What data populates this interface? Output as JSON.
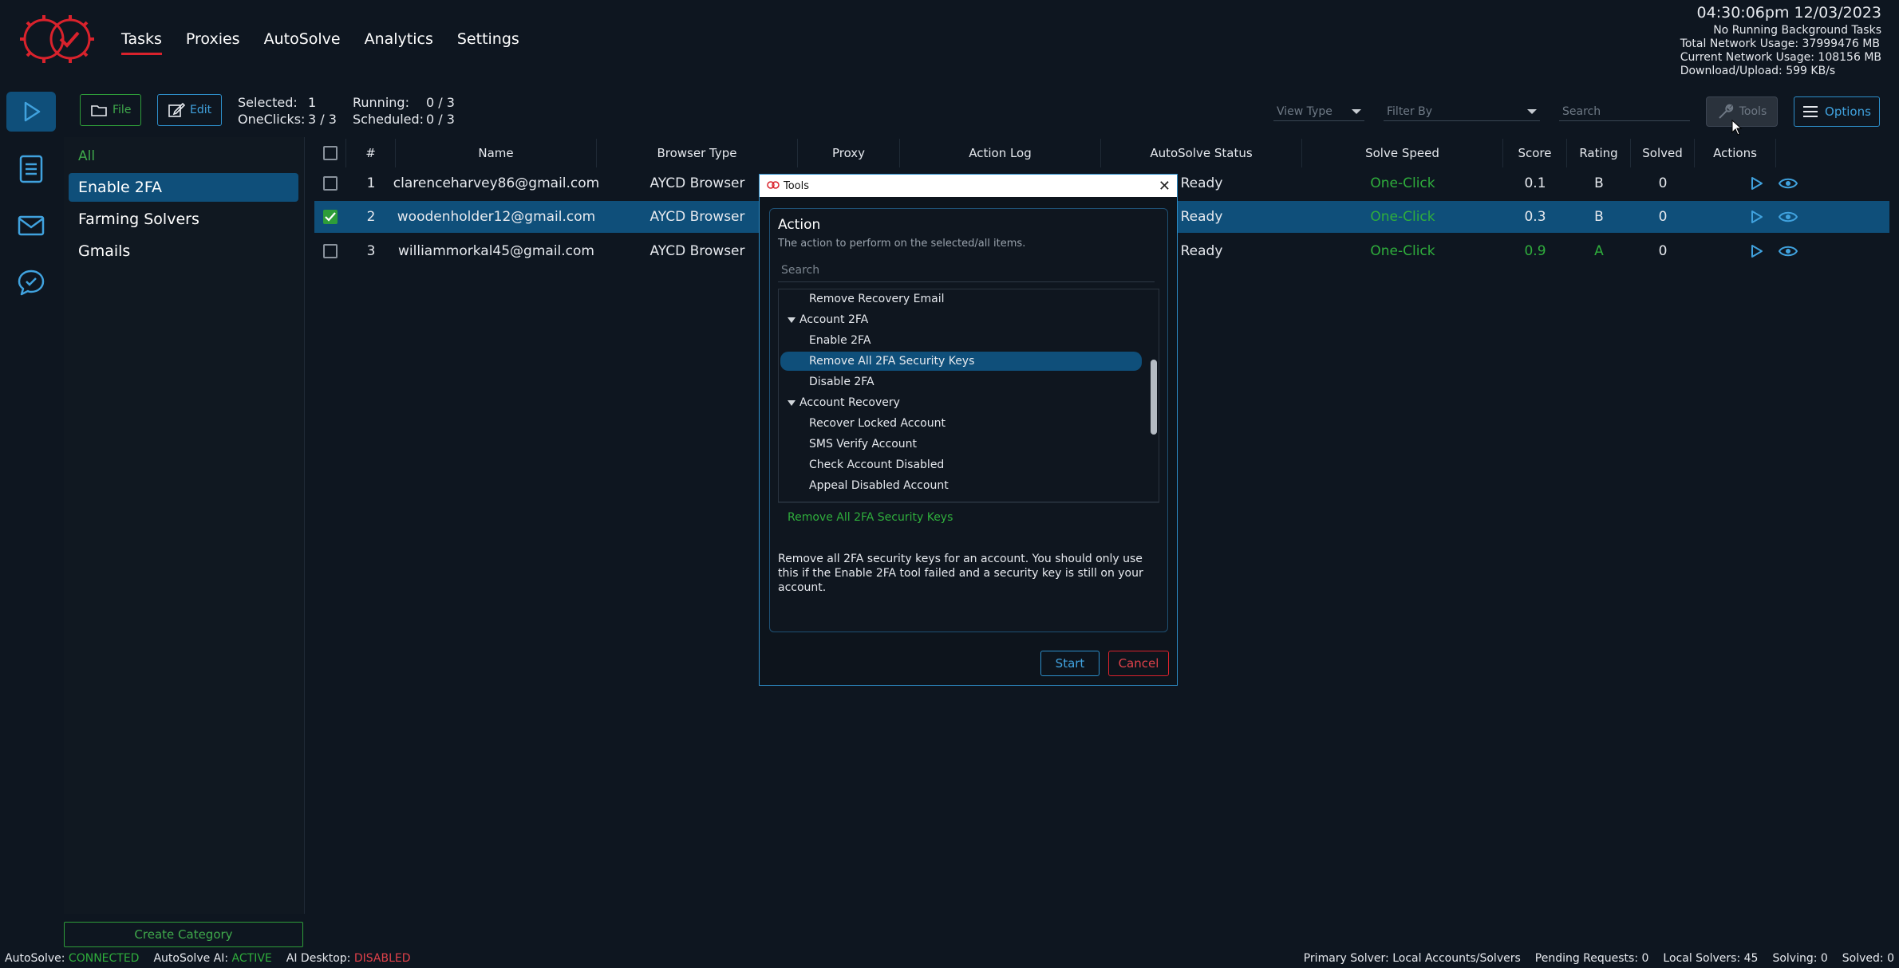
{
  "header": {
    "nav": [
      "Tasks",
      "Proxies",
      "AutoSolve",
      "Analytics",
      "Settings"
    ],
    "active_nav": "Tasks",
    "clock": "04:30:06pm 12/03/2023",
    "background_tasks": "No Running Background Tasks",
    "total_network_label": "Total Network Usage:",
    "total_network_value": "37999476 MB",
    "current_network_label": "Current Network Usage:",
    "current_network_value": "108156 MB",
    "download_upload_label": "Download/Upload:",
    "download_upload_value": "599 KB/s"
  },
  "rail": [
    "play-icon",
    "document-icon",
    "mail-icon",
    "chat-check-icon"
  ],
  "toolbar": {
    "file_label": "File",
    "edit_label": "Edit",
    "selected_label": "Selected:",
    "selected_value": "1",
    "oneclicks_label": "OneClicks:",
    "oneclicks_value": "3 / 3",
    "running_label": "Running:",
    "running_value": "0 / 3",
    "scheduled_label": "Scheduled:",
    "scheduled_value": "0 / 3",
    "view_type_placeholder": "View Type",
    "filter_by_placeholder": "Filter By",
    "search_placeholder": "Search",
    "tools_label": "Tools",
    "options_label": "Options"
  },
  "categories": {
    "all_label": "All",
    "items": [
      "Enable 2FA",
      "Farming Solvers",
      "Gmails"
    ],
    "selected": "Enable 2FA",
    "create_label": "Create Category"
  },
  "table": {
    "headers": [
      "#",
      "Name",
      "Browser Type",
      "Proxy",
      "Action Log",
      "AutoSolve Status",
      "Solve Speed",
      "Score",
      "Rating",
      "Solved",
      "Actions"
    ],
    "rows": [
      {
        "num": "1",
        "name": "clarenceharvey86@gmail.com",
        "browser": "AYCD Browser",
        "status": "Ready",
        "speed": "One-Click",
        "score": "0.1",
        "rating": "B",
        "solved": "0",
        "checked": false
      },
      {
        "num": "2",
        "name": "woodenholder12@gmail.com",
        "browser": "AYCD Browser",
        "status": "Ready",
        "speed": "One-Click",
        "score": "0.3",
        "rating": "B",
        "solved": "0",
        "checked": true
      },
      {
        "num": "3",
        "name": "williammorkal45@gmail.com",
        "browser": "AYCD Browser",
        "status": "Ready",
        "speed": "One-Click",
        "score": "0.9",
        "rating": "A",
        "solved": "0",
        "checked": false
      }
    ]
  },
  "modal": {
    "title": "Tools",
    "action_heading": "Action",
    "action_sub": "The action to perform on the selected/all items.",
    "search_placeholder": "Search",
    "tree": [
      {
        "label": "Remove Recovery Email",
        "type": "child"
      },
      {
        "label": "Account 2FA",
        "type": "parent"
      },
      {
        "label": "Enable 2FA",
        "type": "child"
      },
      {
        "label": "Remove All 2FA Security Keys",
        "type": "child",
        "highlight": true
      },
      {
        "label": "Disable 2FA",
        "type": "child"
      },
      {
        "label": "Account Recovery",
        "type": "parent"
      },
      {
        "label": "Recover Locked Account",
        "type": "child"
      },
      {
        "label": "SMS Verify Account",
        "type": "child"
      },
      {
        "label": "Check Account Disabled",
        "type": "child"
      },
      {
        "label": "Appeal Disabled Account",
        "type": "child"
      }
    ],
    "selected_action": "Remove All 2FA Security Keys",
    "description": "Remove all 2FA security keys for an account. You should only use this if the Enable 2FA tool failed and a security key is still on your account.",
    "start_label": "Start",
    "cancel_label": "Cancel"
  },
  "statusbar": {
    "autosolve_label": "AutoSolve:",
    "autosolve_value": "CONNECTED",
    "autosolve_ai_label": "AutoSolve AI:",
    "autosolve_ai_value": "ACTIVE",
    "ai_desktop_label": "AI Desktop:",
    "ai_desktop_value": "DISABLED",
    "primary_solver": "Primary Solver: Local Accounts/Solvers",
    "pending_requests": "Pending Requests: 0",
    "local_solvers": "Local Solvers: 45",
    "solving": "Solving: 0",
    "solved": "Solved: 0"
  },
  "colors": {
    "accent_blue": "#2d8ec9",
    "selection": "#0f4f7a",
    "green": "#2fae3c",
    "red": "#d9222c"
  }
}
